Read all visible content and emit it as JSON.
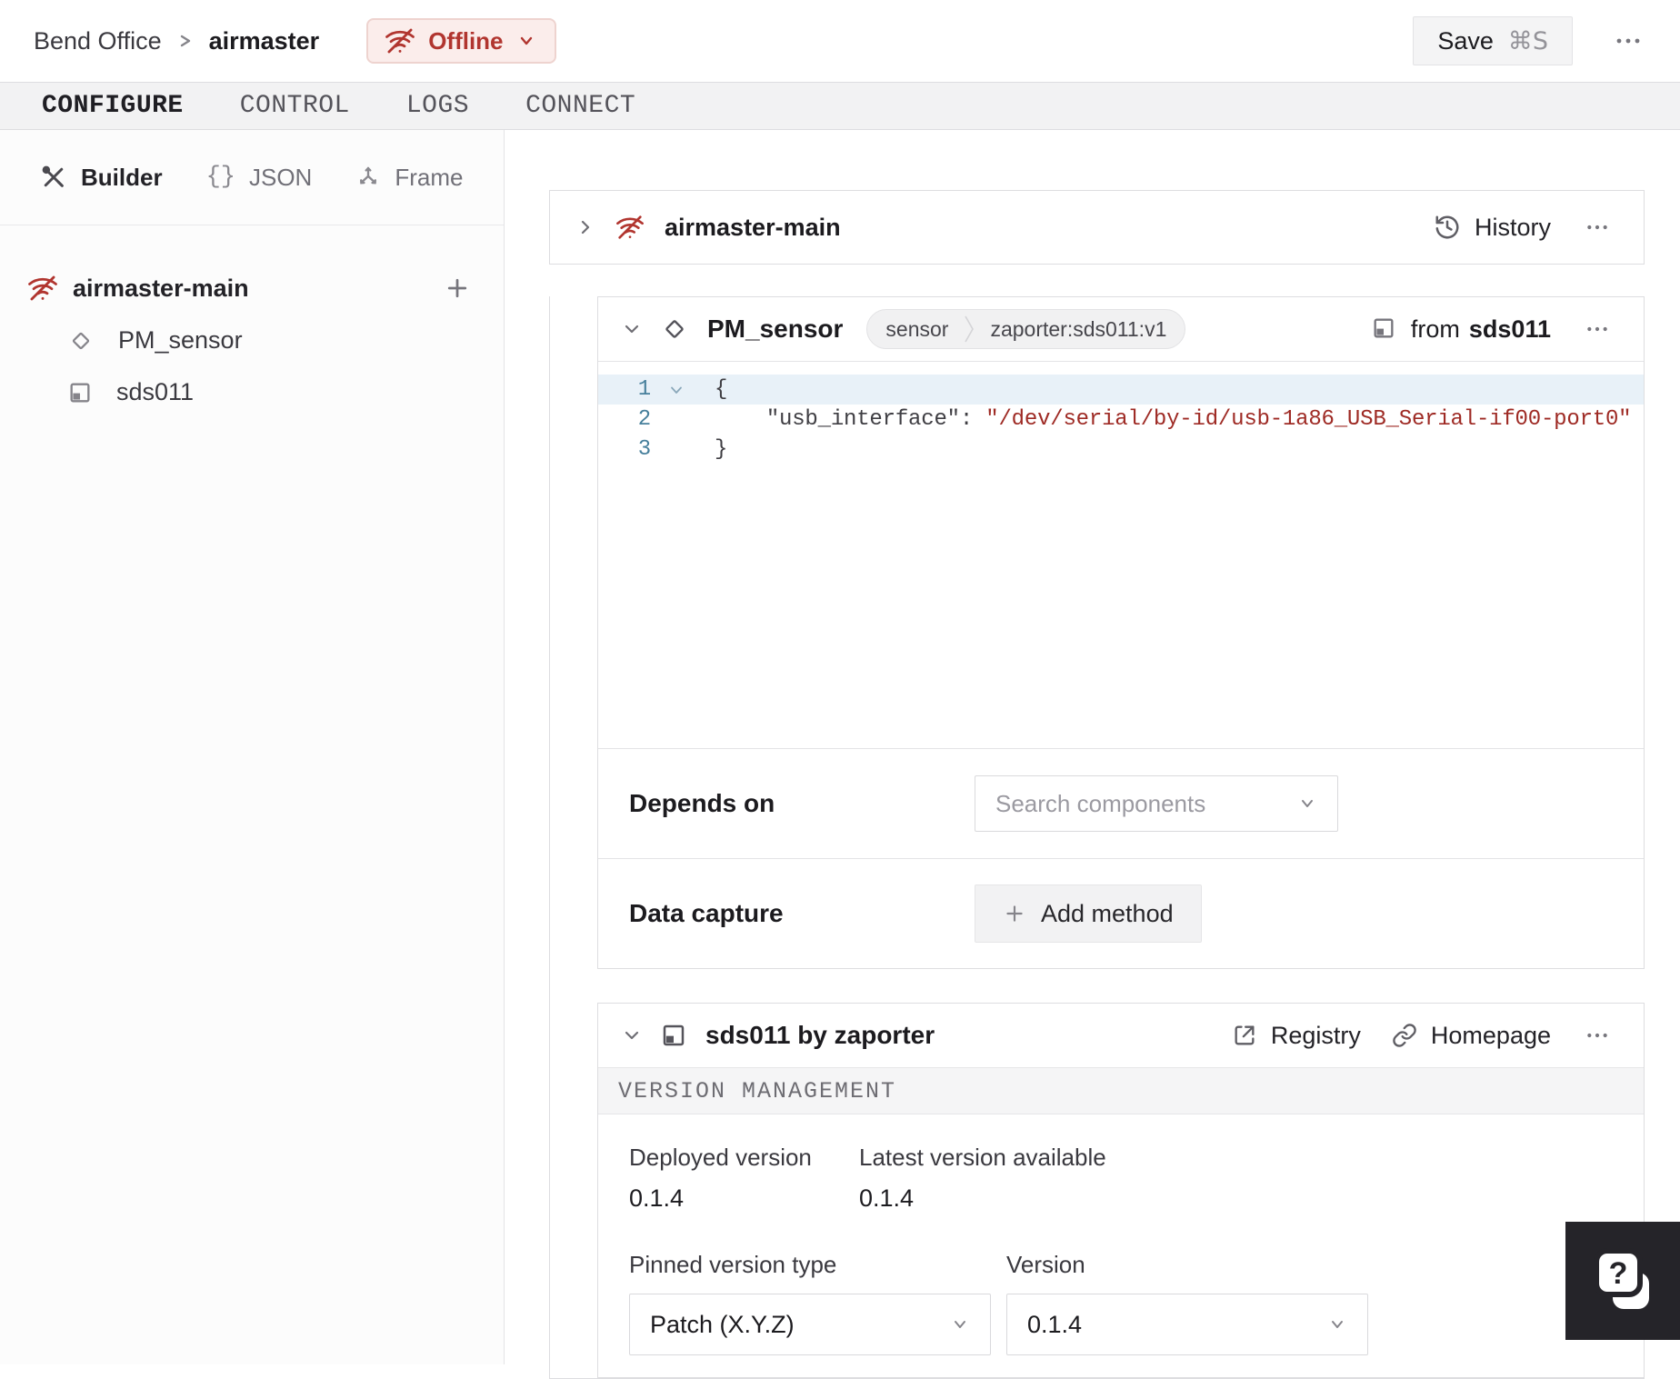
{
  "header": {
    "breadcrumb": {
      "parent": "Bend Office",
      "current": "airmaster"
    },
    "status": {
      "label": "Offline"
    },
    "save": {
      "label": "Save",
      "shortcut": "⌘S"
    }
  },
  "nav_tabs": [
    {
      "label": "CONFIGURE"
    },
    {
      "label": "CONTROL"
    },
    {
      "label": "LOGS"
    },
    {
      "label": "CONNECT"
    }
  ],
  "sidebar": {
    "view_tabs": [
      {
        "label": "Builder"
      },
      {
        "label": "JSON"
      },
      {
        "label": "Frame"
      }
    ],
    "json_icon_glyph": "{}",
    "tree": {
      "root": "airmaster-main",
      "children": [
        {
          "label": "PM_sensor"
        },
        {
          "label": "sds011"
        }
      ]
    }
  },
  "machine_card": {
    "title": "airmaster-main",
    "history": "History"
  },
  "component_card": {
    "title": "PM_sensor",
    "type_badge": "sensor",
    "model_badge": "zaporter:sds011:v1",
    "from_prefix": "from",
    "from_module": "sds011",
    "code": {
      "line_numbers": [
        "1",
        "2",
        "3"
      ],
      "line1": "{",
      "line2_indent": "    ",
      "line2_key": "\"usb_interface\"",
      "line2_sep": ": ",
      "line2_value": "\"/dev/serial/by-id/usb-1a86_USB_Serial-if00-port0\"",
      "line3": "}"
    },
    "depends_on": {
      "label": "Depends on",
      "placeholder": "Search components"
    },
    "data_capture": {
      "label": "Data capture",
      "add_button": "Add method"
    }
  },
  "module_card": {
    "title": "sds011 by zaporter",
    "registry": "Registry",
    "homepage": "Homepage",
    "section_title": "VERSION MANAGEMENT",
    "deployed": {
      "label": "Deployed version",
      "value": "0.1.4"
    },
    "latest": {
      "label": "Latest version available",
      "value": "0.1.4"
    },
    "pinned_type": {
      "label": "Pinned version type",
      "value": "Patch (X.Y.Z)"
    },
    "version": {
      "label": "Version",
      "value": "0.1.4"
    }
  },
  "colors": {
    "accent_red": "#b1352f",
    "status_badge_bg": "#fbedeb",
    "status_badge_border": "#eed3cf",
    "code_string_value": "#9e2a24",
    "code_line_number": "#47809c",
    "active_line_highlight": "#e8f1f8",
    "help_fab_bg": "#252429"
  }
}
